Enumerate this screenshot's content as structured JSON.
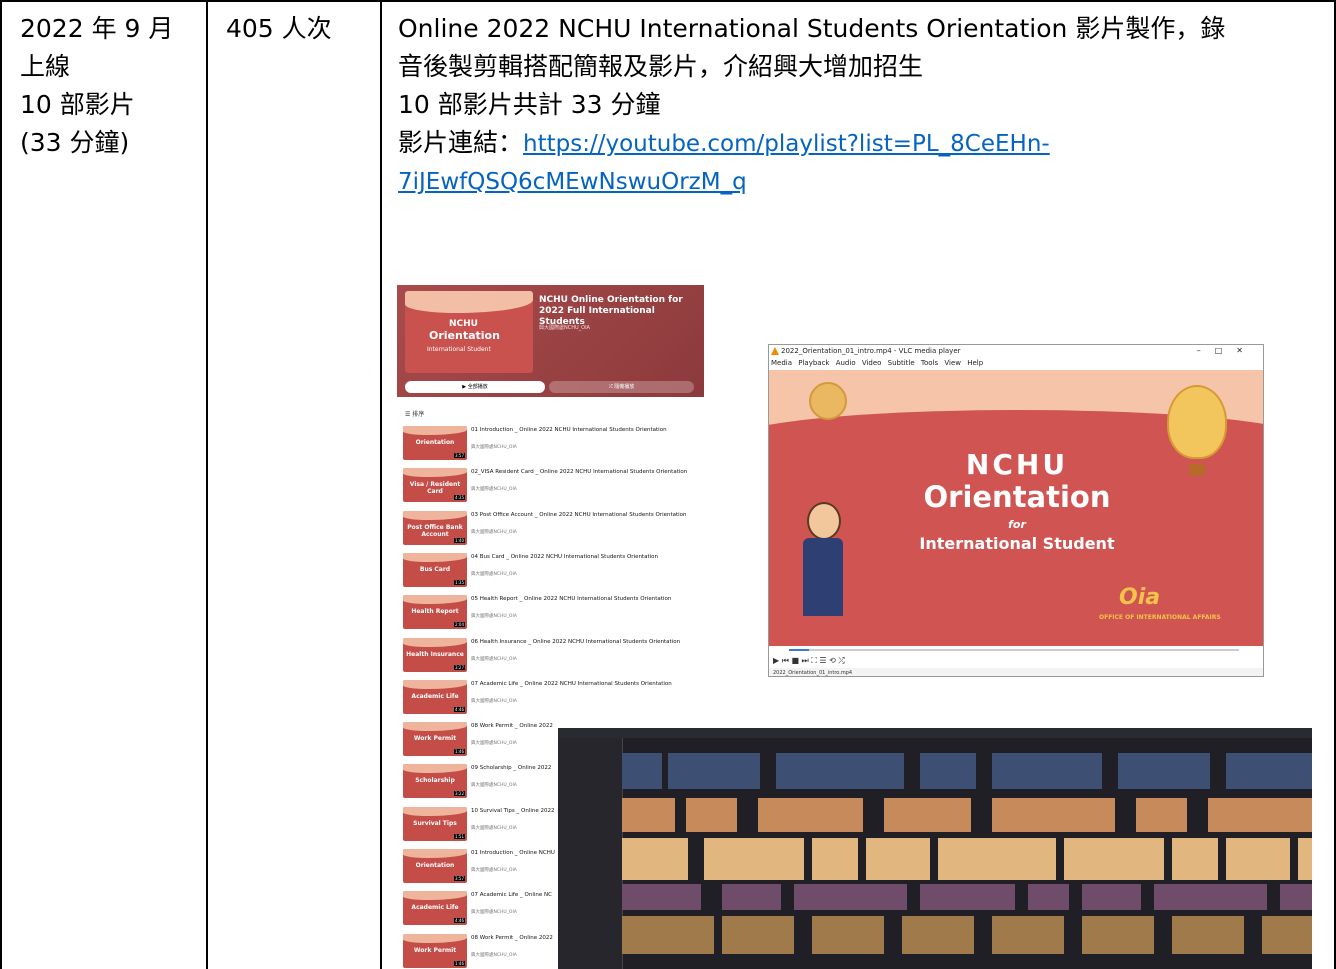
{
  "row": {
    "col1": [
      "2022 年 9 月",
      "上線",
      "10 部影片",
      "(33 分鐘)"
    ],
    "col2": [
      "405 人次"
    ],
    "col3": {
      "lines": [
        "Online 2022 NCHU International Students Orientation 影片製作，錄",
        "音後製剪輯搭配簡報及影片，介紹興大增加招生",
        "10 部影片共計 33 分鐘"
      ],
      "link_label": "影片連結：",
      "link_line1": "https://youtube.com/playlist?list=PL_8CeEHn-",
      "link_line2": "7iJEwfQSQ6cMEwNswuOrzM_q"
    }
  },
  "youtube": {
    "playlist_title": "NCHU Online Orientation for 2022 Full International Students",
    "channel": "興大國際處NCHU_OIA",
    "thumb_brand": "NCHU",
    "thumb_title": "Orientation",
    "thumb_sub": "International Student",
    "play_all": "▶ 全部播放",
    "shuffle": "⤮ 隨機播放",
    "sort": "☰ 排序",
    "videos": [
      {
        "title": "01 Introduction _ Online 2022 NCHU International Students Orientation",
        "thumb": "Orientation",
        "dur": "3:57"
      },
      {
        "title": "02_VISA Resident Card _ Online 2022 NCHU International Students Orientation",
        "thumb": "Visa / Resident Card",
        "dur": "4:35"
      },
      {
        "title": "03 Post Office Account _ Online 2022 NCHU International Students Orientation",
        "thumb": "Post Office Bank Account",
        "dur": "1:40"
      },
      {
        "title": "04 Bus Card _ Online 2022 NCHU International Students Orientation",
        "thumb": "Bus Card",
        "dur": "1:35"
      },
      {
        "title": "05 Health Report _ Online 2022 NCHU International Students Orientation",
        "thumb": "Health Report",
        "dur": "2:04"
      },
      {
        "title": "06 Health Insurance _ Online 2022 NCHU International Students Orientation",
        "thumb": "Health Insurance",
        "dur": "3:27"
      },
      {
        "title": "07 Academic Life _ Online 2022 NCHU International Students Orientation",
        "thumb": "Academic Life",
        "dur": "4:46"
      },
      {
        "title": "08 Work Permit _ Online 2022",
        "thumb": "Work Permit",
        "dur": "1:46"
      },
      {
        "title": "09 Scholarship _ Online 2022",
        "thumb": "Scholarship",
        "dur": "3:22"
      },
      {
        "title": "10 Survival Tips _ Online 2022",
        "thumb": "Survival Tips",
        "dur": "1:51"
      },
      {
        "title": "01 Introduction _ Online NCHU",
        "thumb": "Orientation",
        "dur": "3:57"
      },
      {
        "title": "07 Academic Life _ Online NC",
        "thumb": "Academic Life",
        "dur": "4:46"
      },
      {
        "title": "08 Work Permit _ Online 2022",
        "thumb": "Work Permit",
        "dur": "1:46"
      }
    ]
  },
  "vlc": {
    "window_title": "2022_Orientation_01_intro.mp4 - VLC media player",
    "menu": "Media  Playback  Audio  Video  Subtitle  Tools  View  Help",
    "brand": "NCHU",
    "title": "Orientation",
    "for": "for",
    "subtitle": "International Student",
    "oia": "Oia",
    "oia_text": "OFFICE OF INTERNATIONAL AFFAIRS",
    "status": "2022_Orientation_01_intro.mp4"
  }
}
